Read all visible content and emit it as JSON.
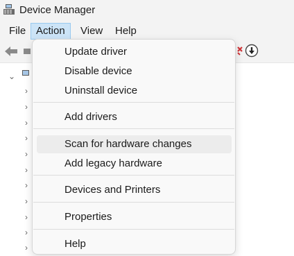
{
  "window": {
    "title": "Device Manager",
    "app_icon": "device-manager-icon"
  },
  "menubar": {
    "items": [
      {
        "label": "File",
        "active": false
      },
      {
        "label": "Action",
        "active": true
      },
      {
        "label": "View",
        "active": false
      },
      {
        "label": "Help",
        "active": false
      }
    ]
  },
  "toolbar": {
    "icons": [
      "back-arrow-icon",
      "forward-arrow-icon",
      "uninstall-x-icon",
      "download-driver-icon"
    ]
  },
  "action_menu": {
    "groups": [
      [
        "Update driver",
        "Disable device",
        "Uninstall device"
      ],
      [
        "Add drivers"
      ],
      [
        "Scan for hardware changes",
        "Add legacy hardware"
      ],
      [
        "Devices and Printers"
      ],
      [
        "Properties"
      ],
      [
        "Help"
      ]
    ],
    "hovered": "Scan for hardware changes"
  },
  "tree": {
    "root_icon": "computer-icon",
    "child_chevron_icon": "chevron-right-icon",
    "root_chevron_icon": "chevron-down-icon"
  },
  "colors": {
    "menu_active_bg": "#cce4f7",
    "menu_active_border": "#99c9ef",
    "hover_bg": "#ececec",
    "uninstall_red": "#d13438"
  }
}
